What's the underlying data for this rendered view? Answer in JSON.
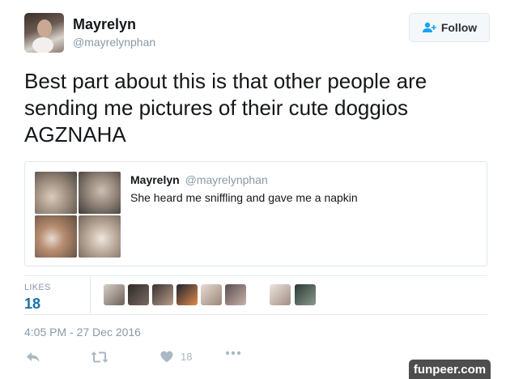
{
  "author": {
    "display_name": "Mayrelyn",
    "handle": "@mayrelynphan"
  },
  "follow_button": {
    "label": "Follow",
    "icon": "add-person-icon",
    "accent": "#1da1f2"
  },
  "tweet": {
    "text": "Best part about this is that other people are sending me pictures of their cute doggios AGZNAHA"
  },
  "quoted_tweet": {
    "display_name": "Mayrelyn",
    "handle": "@mayrelynphan",
    "text": "She heard me sniffling and gave me a napkin",
    "photo_count": 4
  },
  "likes": {
    "label": "LIKES",
    "count": "18",
    "liker_avatar_count": 9
  },
  "timestamp": "4:05 PM - 27 Dec 2016",
  "actions": {
    "reply_icon": "reply-icon",
    "retweet_icon": "retweet-icon",
    "like_icon": "heart-icon",
    "like_count": "18",
    "more_icon": "more-dots-icon"
  },
  "watermark": "funpeer.com",
  "colors": {
    "text": "#14171a",
    "muted": "#8899a6",
    "likes_count": "#1b6fa8",
    "border": "#e1e8ed",
    "icon": "#aab8c2"
  }
}
